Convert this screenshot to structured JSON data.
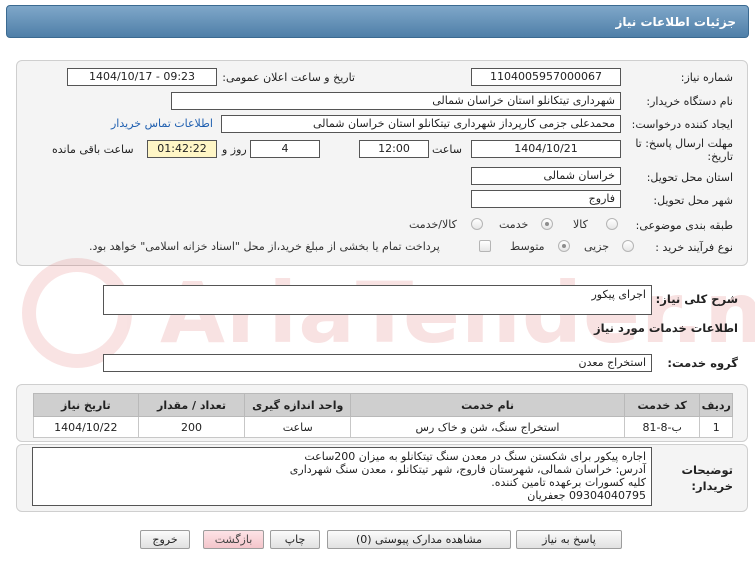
{
  "header": {
    "title": "جزئیات اطلاعات نیاز"
  },
  "form": {
    "need_number": {
      "label": "شماره نیاز:",
      "value": "1104005957000067"
    },
    "announce_datetime": {
      "label": "تاریخ و ساعت اعلان عمومی:",
      "value": "1404/10/17 - 09:23"
    },
    "buyer_org": {
      "label": "نام دستگاه خریدار:",
      "value": "شهرداری تیتکانلو استان خراسان شمالی"
    },
    "requester": {
      "label": "ایجاد کننده درخواست:",
      "value": "محمدعلی جزمی کارپرداز شهرداری تیتکانلو استان خراسان شمالی"
    },
    "buyer_contact_link": "اطلاعات تماس خریدار",
    "deadline": {
      "label": "مهلت ارسال پاسخ: تا تاریخ:",
      "date": "1404/10/21",
      "time_label": "ساعت",
      "time": "12:00",
      "days": "4",
      "days_label": "روز و",
      "remaining": "01:42:22",
      "remaining_label": "ساعت باقی مانده"
    },
    "province": {
      "label": "استان محل تحویل:",
      "value": "خراسان شمالی"
    },
    "city": {
      "label": "شهر محل تحویل:",
      "value": "فاروج"
    },
    "category": {
      "label": "طبقه بندی موضوعی:",
      "options": [
        "کالا",
        "خدمت",
        "کالا/خدمت"
      ],
      "selected": "خدمت"
    },
    "process_type": {
      "label": "نوع فرآیند خرید :",
      "options": [
        "جزیی",
        "متوسط"
      ],
      "selected": "متوسط",
      "payment_note": "پرداخت تمام یا بخشی از مبلغ خرید،از محل \"اسناد خزانه اسلامی\" خواهد بود."
    }
  },
  "need_summary": {
    "label": "شرح کلی نیاز:",
    "value": "اجرای پیکور"
  },
  "services_section": {
    "title": "اطلاعات خدمات مورد نیاز"
  },
  "service_group": {
    "label": "گروه خدمت:",
    "value": "استخراج معدن"
  },
  "table": {
    "columns": [
      "ردیف",
      "کد خدمت",
      "نام خدمت",
      "واحد اندازه گیری",
      "تعداد / مقدار",
      "تاریخ نیاز"
    ],
    "rows": [
      [
        "1",
        "ب-8-81",
        "استخراج سنگ، شن و خاک رس",
        "ساعت",
        "200",
        "1404/10/22"
      ]
    ]
  },
  "buyer_notes": {
    "label": "توضیحات خریدار:",
    "lines": [
      "اجاره پیکور برای شکستن سنگ در معدن سنگ تیتکانلو به میزان 200ساعت",
      "آدرس: خراسان شمالی، شهرستان فاروج، شهر تیتکانلو ، معدن سنگ شهرداری",
      "کلیه کسورات برعهده تامین کننده.",
      "09304040795 جعفریان"
    ]
  },
  "buttons": {
    "reply": "پاسخ به نیاز",
    "attachments": "مشاهده مدارک پیوستی (0)",
    "print": "چاپ",
    "back": "بازگشت",
    "exit": "خروج"
  },
  "watermark": {
    "text": "AriaTender.neT"
  }
}
